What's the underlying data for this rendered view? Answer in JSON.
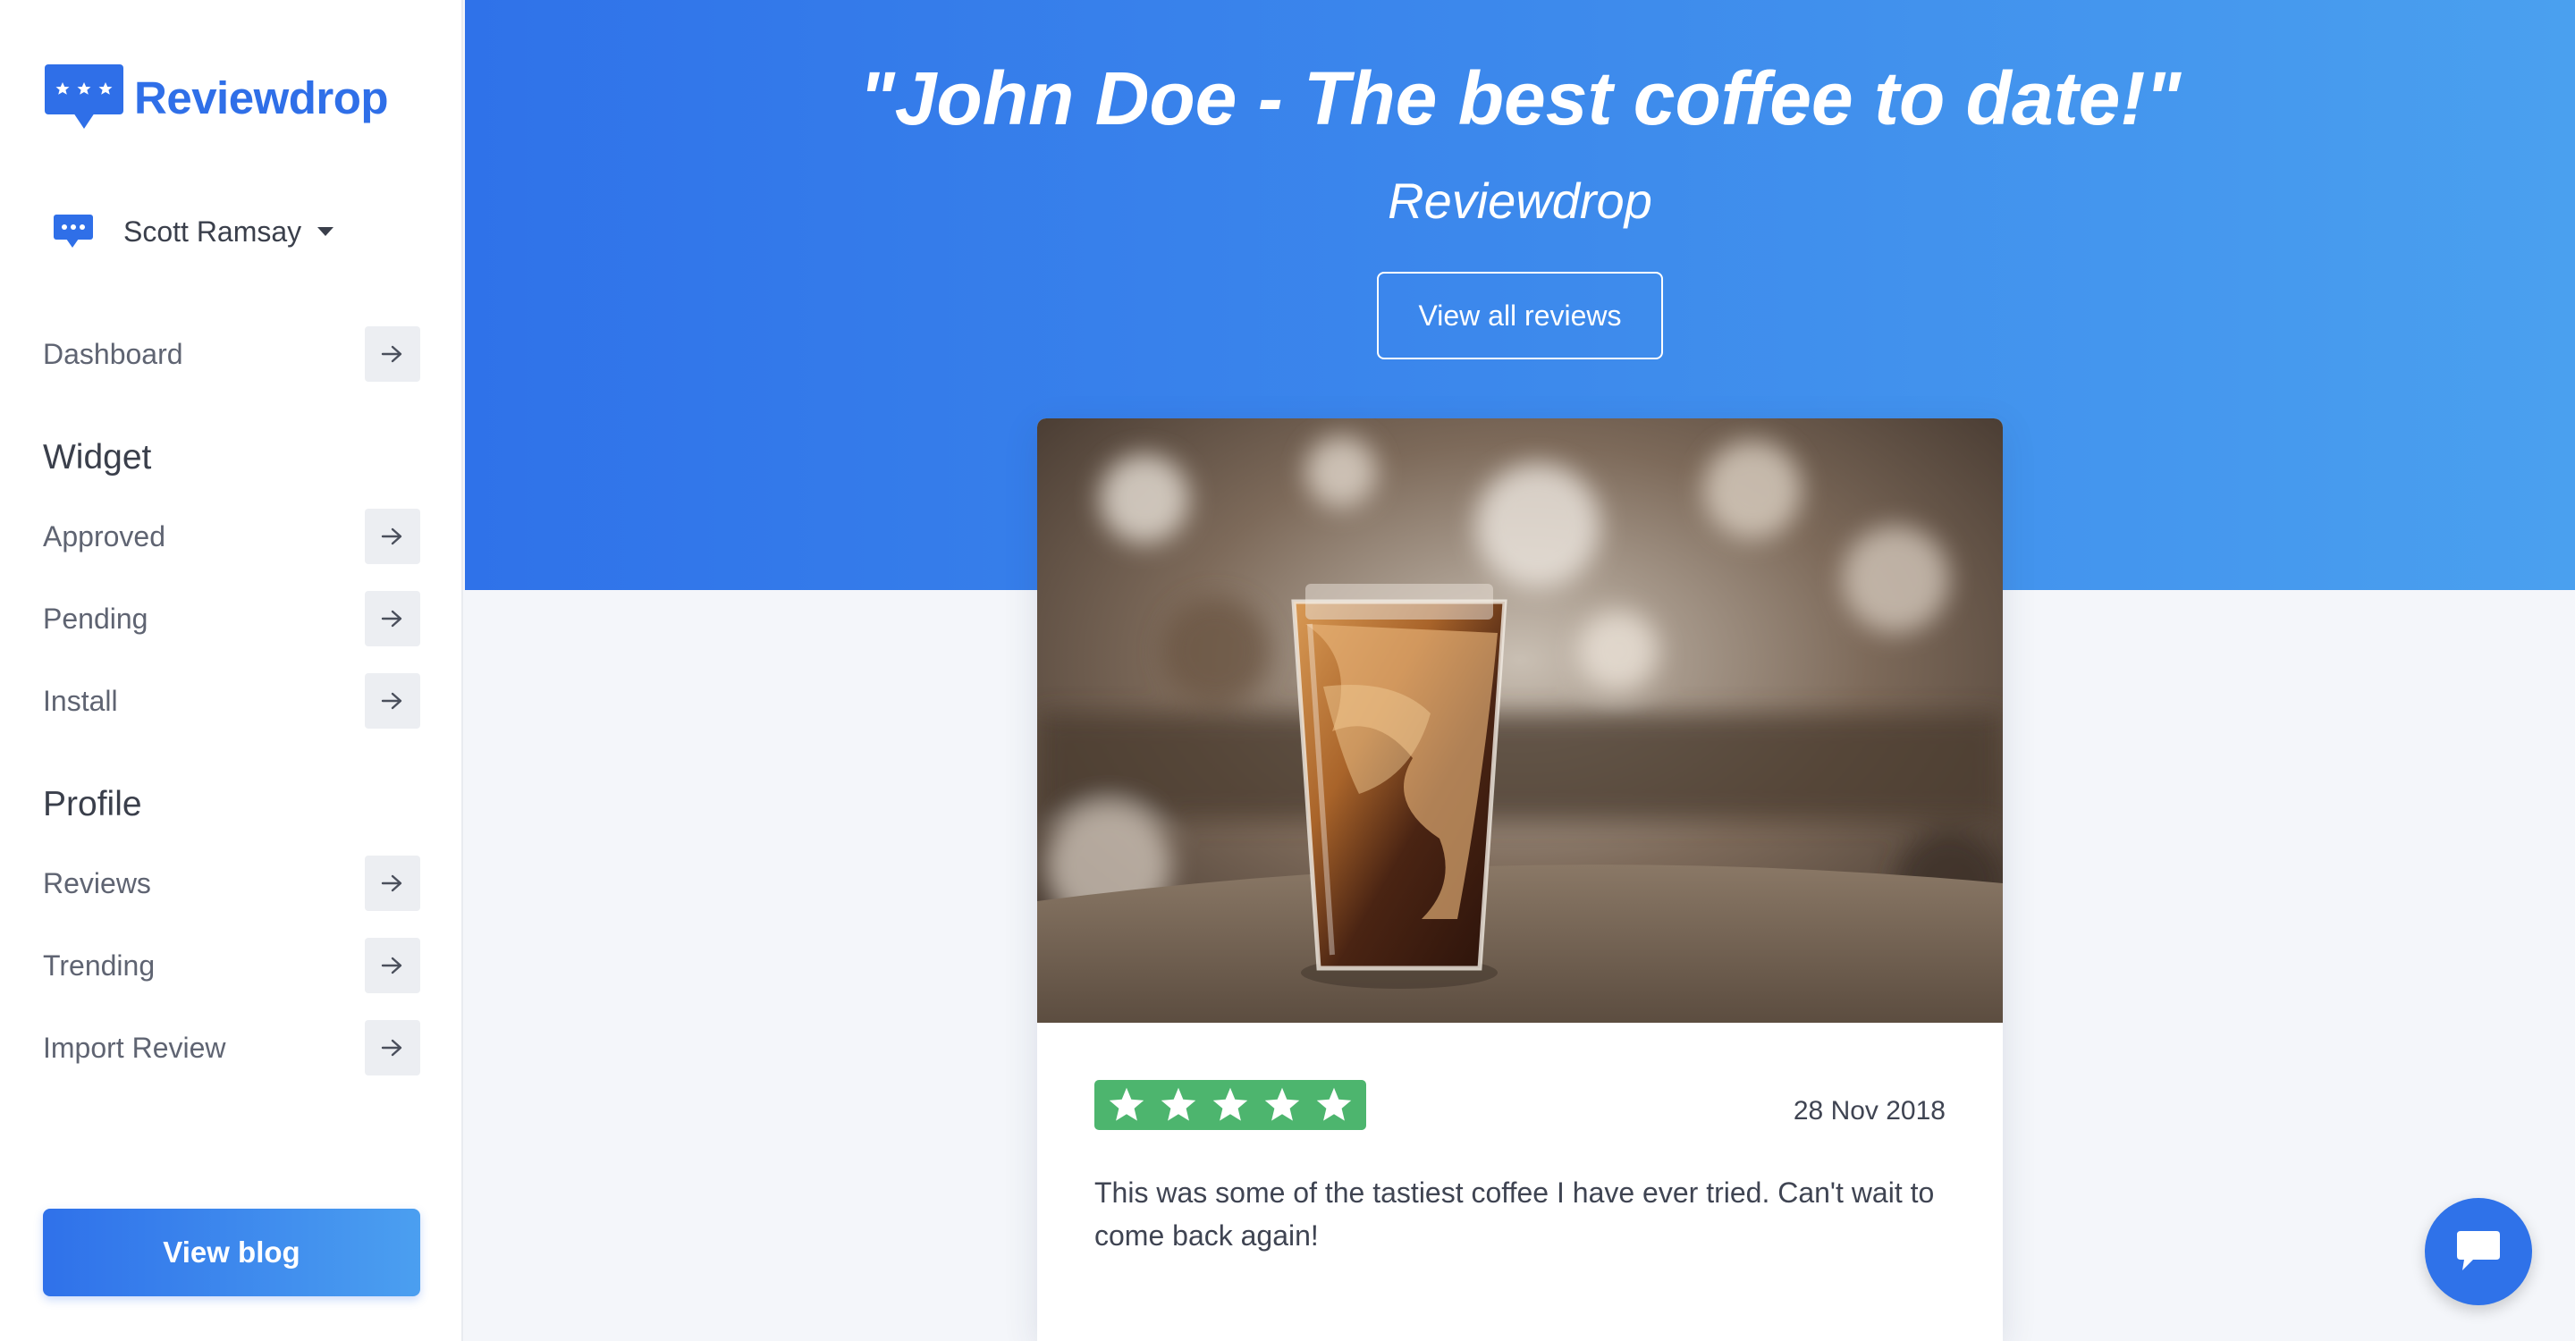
{
  "brand": {
    "name": "Reviewdrop",
    "color": "#2f6fe8"
  },
  "user": {
    "name": "Scott Ramsay"
  },
  "sidebar": {
    "dashboard": "Dashboard",
    "widget_heading": "Widget",
    "widget_items": [
      "Approved",
      "Pending",
      "Install"
    ],
    "profile_heading": "Profile",
    "profile_items": [
      "Reviews",
      "Trending",
      "Import Review"
    ],
    "blog_button": "View blog"
  },
  "hero": {
    "title": "\"John Doe - The best coffee to date!\"",
    "subtitle": "Reviewdrop",
    "button": "View all reviews",
    "gradient": [
      "#2f72e9",
      "#4aa0ef"
    ]
  },
  "review": {
    "rating": 5,
    "max_rating": 5,
    "rating_color": "#4db56e",
    "date": "28 Nov 2018",
    "text": "This was some of the tastiest coffee I have ever tried. Can't wait to come back again!"
  },
  "icons": {
    "logo": "speech-bubble-stars-icon",
    "user": "chat-bubble-icon",
    "nav_arrow": "arrow-right-icon",
    "chat": "chat-icon"
  }
}
